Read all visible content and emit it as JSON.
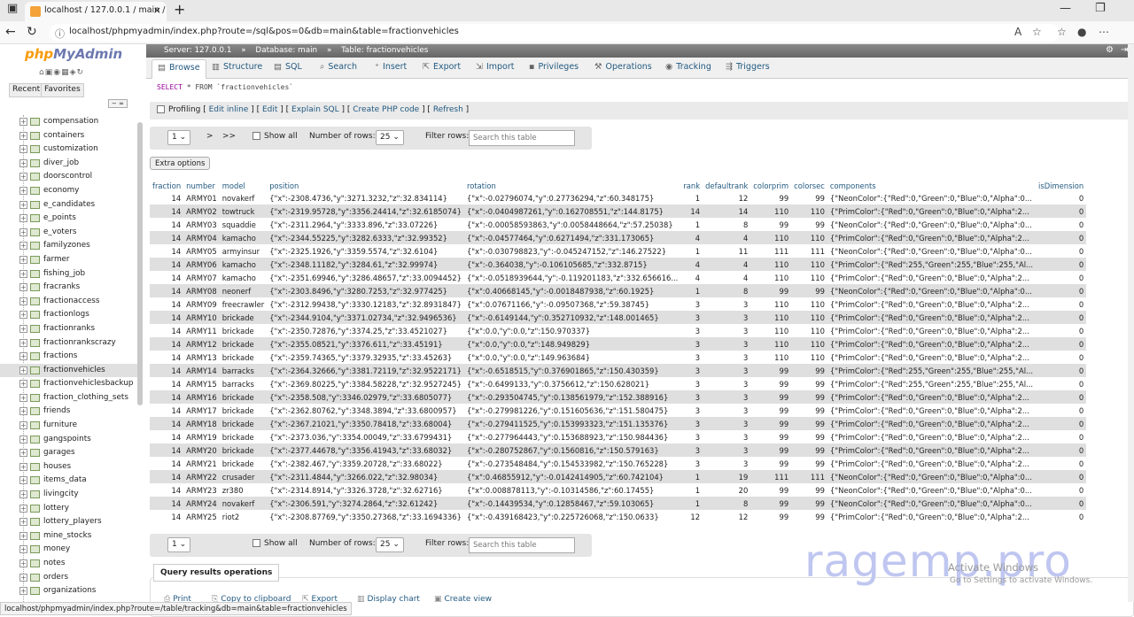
{
  "browser": {
    "tab_title": "localhost / 127.0.0.1 / main / fract",
    "url": "localhost/phpmyadmin/index.php?route=/sql&pos=0&db=main&table=fractionvehicles"
  },
  "sidebar": {
    "logo_php": "php",
    "logo_myadmin": "MyAdmin",
    "recent": "Recent",
    "favorites": "Favorites",
    "items": [
      "compensation",
      "containers",
      "customization",
      "diver_job",
      "doorscontrol",
      "economy",
      "e_candidates",
      "e_points",
      "e_voters",
      "familyzones",
      "farmer",
      "fishing_job",
      "fracranks",
      "fractionaccess",
      "fractionlogs",
      "fractionranks",
      "fractionrankscrazy",
      "fractions",
      "fractionvehicles",
      "fractionvehiclesbackup",
      "fraction_clothing_sets",
      "friends",
      "furniture",
      "gangspoints",
      "garages",
      "houses",
      "items_data",
      "livingcity",
      "lottery",
      "lottery_players",
      "mine_stocks",
      "money",
      "notes",
      "orders",
      "organizations"
    ],
    "active": "fractionvehicles"
  },
  "breadcrumb": {
    "server": "Server: 127.0.0.1",
    "database": "Database: main",
    "table": "Table: fractionvehicles"
  },
  "menu": {
    "browse": "Browse",
    "structure": "Structure",
    "sql": "SQL",
    "search": "Search",
    "insert": "Insert",
    "export": "Export",
    "import": "Import",
    "privileges": "Privileges",
    "operations": "Operations",
    "tracking": "Tracking",
    "triggers": "Triggers"
  },
  "query": {
    "select": "SELECT",
    "rest": " * FROM `fractionvehicles`"
  },
  "profiling": {
    "label": "Profiling",
    "edit_inline": "Edit inline",
    "edit": "Edit",
    "explain": "Explain SQL",
    "create_php": "Create PHP code",
    "refresh": "Refresh"
  },
  "nav": {
    "page": "1",
    "next": ">",
    "last": ">>",
    "show_all": "Show all",
    "rows_label": "Number of rows:",
    "rows_value": "25",
    "filter_label": "Filter rows:",
    "filter_placeholder": "Search this table"
  },
  "extra_options": "Extra options",
  "table": {
    "headers": [
      "fraction",
      "number",
      "model",
      "position",
      "rotation",
      "rank",
      "defaultrank",
      "colorprim",
      "colorsec",
      "components",
      "isDimension"
    ],
    "rows": [
      [
        "14",
        "ARMY01",
        "novakerf",
        "{\"x\":-2308.4736,\"y\":3271.3232,\"z\":32.834114}",
        "{\"x\":-0.02796074,\"y\":0.27736294,\"z\":60.348175}",
        "1",
        "12",
        "99",
        "99",
        "{\"NeonColor\":{\"Red\":0,\"Green\":0,\"Blue\":0,\"Alpha\":0...",
        "0"
      ],
      [
        "14",
        "ARMY02",
        "towtruck",
        "{\"x\":-2319.95728,\"y\":3356.24414,\"z\":32.6185074}",
        "{\"x\":-0.0404987261,\"y\":0.162708551,\"z\":144.8175}",
        "14",
        "14",
        "110",
        "110",
        "{\"PrimColor\":{\"Red\":0,\"Green\":0,\"Blue\":0,\"Alpha\":2...",
        "0"
      ],
      [
        "14",
        "ARMY03",
        "squaddie",
        "{\"x\":-2311.2964,\"y\":3333.896,\"z\":33.07226}",
        "{\"x\":-0.00058593863,\"y\":0.0058448664,\"z\":57.25038}",
        "1",
        "8",
        "99",
        "99",
        "{\"NeonColor\":{\"Red\":0,\"Green\":0,\"Blue\":0,\"Alpha\":0...",
        "0"
      ],
      [
        "14",
        "ARMY04",
        "kamacho",
        "{\"x\":-2344.55225,\"y\":3282.6333,\"z\":32.99352}",
        "{\"x\":-0.04577464,\"y\":0.6271494,\"z\":331.173065}",
        "4",
        "4",
        "110",
        "110",
        "{\"PrimColor\":{\"Red\":0,\"Green\":0,\"Blue\":0,\"Alpha\":2...",
        "0"
      ],
      [
        "14",
        "ARMY05",
        "armyinsur",
        "{\"x\":-2325.1926,\"y\":3359.5574,\"z\":32.6104}",
        "{\"x\":-0.030798823,\"y\":-0.045247152,\"z\":146.27522}",
        "1",
        "11",
        "111",
        "111",
        "{\"NeonColor\":{\"Red\":0,\"Green\":0,\"Blue\":0,\"Alpha\":0...",
        "0"
      ],
      [
        "14",
        "ARMY06",
        "kamacho",
        "{\"x\":-2348.11182,\"y\":3284.61,\"z\":32.99974}",
        "{\"x\":-0.364038,\"y\":-0.106105685,\"z\":332.8715}",
        "4",
        "4",
        "110",
        "110",
        "{\"PrimColor\":{\"Red\":255,\"Green\":255,\"Blue\":255,\"Al...",
        "0"
      ],
      [
        "14",
        "ARMY07",
        "kamacho",
        "{\"x\":-2351.69946,\"y\":3286.48657,\"z\":33.0094452}",
        "{\"x\":-0.0518939644,\"y\":-0.119201183,\"z\":332.656616...",
        "4",
        "4",
        "110",
        "110",
        "{\"PrimColor\":{\"Red\":0,\"Green\":0,\"Blue\":0,\"Alpha\":2...",
        "0"
      ],
      [
        "14",
        "ARMY08",
        "neonerf",
        "{\"x\":-2303.8496,\"y\":3280.7253,\"z\":32.977425}",
        "{\"x\":0.40668145,\"y\":-0.0018487938,\"z\":60.1925}",
        "1",
        "8",
        "99",
        "99",
        "{\"NeonColor\":{\"Red\":0,\"Green\":0,\"Blue\":0,\"Alpha\":0...",
        "0"
      ],
      [
        "14",
        "ARMY09",
        "freecrawler",
        "{\"x\":-2312.99438,\"y\":3330.12183,\"z\":32.8931847}",
        "{\"x\":0.07671166,\"y\":-0.09507368,\"z\":59.38745}",
        "3",
        "3",
        "110",
        "110",
        "{\"PrimColor\":{\"Red\":0,\"Green\":0,\"Blue\":0,\"Alpha\":2...",
        "0"
      ],
      [
        "14",
        "ARMY10",
        "brickade",
        "{\"x\":-2344.9104,\"y\":3371.02734,\"z\":32.9496536}",
        "{\"x\":-0.6149144,\"y\":0.352710932,\"z\":148.001465}",
        "3",
        "3",
        "110",
        "110",
        "{\"PrimColor\":{\"Red\":0,\"Green\":0,\"Blue\":0,\"Alpha\":2...",
        "0"
      ],
      [
        "14",
        "ARMY11",
        "brickade",
        "{\"x\":-2350.72876,\"y\":3374.25,\"z\":33.4521027}",
        "{\"x\":0.0,\"y\":0.0,\"z\":150.970337}",
        "3",
        "3",
        "110",
        "110",
        "{\"PrimColor\":{\"Red\":0,\"Green\":0,\"Blue\":0,\"Alpha\":2...",
        "0"
      ],
      [
        "14",
        "ARMY12",
        "brickade",
        "{\"x\":-2355.08521,\"y\":3376.611,\"z\":33.45191}",
        "{\"x\":0.0,\"y\":0.0,\"z\":148.949829}",
        "3",
        "3",
        "110",
        "110",
        "{\"PrimColor\":{\"Red\":0,\"Green\":0,\"Blue\":0,\"Alpha\":2...",
        "0"
      ],
      [
        "14",
        "ARMY13",
        "brickade",
        "{\"x\":-2359.74365,\"y\":3379.32935,\"z\":33.45263}",
        "{\"x\":0.0,\"y\":0.0,\"z\":149.963684}",
        "3",
        "3",
        "110",
        "110",
        "{\"PrimColor\":{\"Red\":0,\"Green\":0,\"Blue\":0,\"Alpha\":2...",
        "0"
      ],
      [
        "14",
        "ARMY14",
        "barracks",
        "{\"x\":-2364.32666,\"y\":3381.72119,\"z\":32.9522171}",
        "{\"x\":-0.6518515,\"y\":0.376901865,\"z\":150.430359}",
        "3",
        "3",
        "99",
        "99",
        "{\"PrimColor\":{\"Red\":255,\"Green\":255,\"Blue\":255,\"Al...",
        "0"
      ],
      [
        "14",
        "ARMY15",
        "barracks",
        "{\"x\":-2369.80225,\"y\":3384.58228,\"z\":32.9527245}",
        "{\"x\":-0.6499133,\"y\":0.3756612,\"z\":150.628021}",
        "3",
        "3",
        "99",
        "99",
        "{\"PrimColor\":{\"Red\":255,\"Green\":255,\"Blue\":255,\"Al...",
        "0"
      ],
      [
        "14",
        "ARMY16",
        "brickade",
        "{\"x\":-2358.508,\"y\":3346.02979,\"z\":33.6805077}",
        "{\"x\":-0.293504745,\"y\":0.138561979,\"z\":152.388916}",
        "3",
        "3",
        "99",
        "99",
        "{\"PrimColor\":{\"Red\":0,\"Green\":0,\"Blue\":0,\"Alpha\":2...",
        "0"
      ],
      [
        "14",
        "ARMY17",
        "brickade",
        "{\"x\":-2362.80762,\"y\":3348.3894,\"z\":33.6800957}",
        "{\"x\":-0.279981226,\"y\":0.151605636,\"z\":151.580475}",
        "3",
        "3",
        "99",
        "99",
        "{\"PrimColor\":{\"Red\":0,\"Green\":0,\"Blue\":0,\"Alpha\":2...",
        "0"
      ],
      [
        "14",
        "ARMY18",
        "brickade",
        "{\"x\":-2367.21021,\"y\":3350.78418,\"z\":33.68004}",
        "{\"x\":-0.279411525,\"y\":0.153993323,\"z\":151.135376}",
        "3",
        "3",
        "99",
        "99",
        "{\"PrimColor\":{\"Red\":0,\"Green\":0,\"Blue\":0,\"Alpha\":2...",
        "0"
      ],
      [
        "14",
        "ARMY19",
        "brickade",
        "{\"x\":-2373.036,\"y\":3354.00049,\"z\":33.6799431}",
        "{\"x\":-0.277964443,\"y\":0.153688923,\"z\":150.984436}",
        "3",
        "3",
        "99",
        "99",
        "{\"PrimColor\":{\"Red\":0,\"Green\":0,\"Blue\":0,\"Alpha\":2...",
        "0"
      ],
      [
        "14",
        "ARMY20",
        "brickade",
        "{\"x\":-2377.44678,\"y\":3356.41943,\"z\":33.68032}",
        "{\"x\":-0.280752867,\"y\":0.1560816,\"z\":150.579163}",
        "3",
        "3",
        "99",
        "99",
        "{\"PrimColor\":{\"Red\":0,\"Green\":0,\"Blue\":0,\"Alpha\":2...",
        "0"
      ],
      [
        "14",
        "ARMY21",
        "brickade",
        "{\"x\":-2382.467,\"y\":3359.20728,\"z\":33.68022}",
        "{\"x\":-0.273548484,\"y\":0.154533982,\"z\":150.765228}",
        "3",
        "3",
        "99",
        "99",
        "{\"PrimColor\":{\"Red\":0,\"Green\":0,\"Blue\":0,\"Alpha\":2...",
        "0"
      ],
      [
        "14",
        "ARMY22",
        "crusader",
        "{\"x\":-2311.4844,\"y\":3266.022,\"z\":32.98034}",
        "{\"x\":0.46855912,\"y\":-0.0142414905,\"z\":60.742104}",
        "1",
        "19",
        "111",
        "111",
        "{\"NeonColor\":{\"Red\":0,\"Green\":0,\"Blue\":0,\"Alpha\":0...",
        "0"
      ],
      [
        "14",
        "ARMY23",
        "zr380",
        "{\"x\":-2314.8914,\"y\":3326.3728,\"z\":32.62716}",
        "{\"x\":0.008878113,\"y\":-0.10314586,\"z\":60.17455}",
        "1",
        "20",
        "99",
        "99",
        "{\"NeonColor\":{\"Red\":0,\"Green\":0,\"Blue\":0,\"Alpha\":0...",
        "0"
      ],
      [
        "14",
        "ARMY24",
        "novakerf",
        "{\"x\":-2306.591,\"y\":3274.2864,\"z\":32.61242}",
        "{\"x\":-0.14439534,\"y\":0.12858467,\"z\":59.103065}",
        "1",
        "8",
        "99",
        "99",
        "{\"NeonColor\":{\"Red\":0,\"Green\":0,\"Blue\":0,\"Alpha\":0...",
        "0"
      ],
      [
        "14",
        "ARMY25",
        "riot2",
        "{\"x\":-2308.87769,\"y\":3350.27368,\"z\":33.1694336}",
        "{\"x\":-0.439168423,\"y\":0.225726068,\"z\":150.0633}",
        "12",
        "12",
        "99",
        "99",
        "{\"PrimColor\":{\"Red\":0,\"Green\":0,\"Blue\":0,\"Alpha\":2...",
        "0"
      ]
    ]
  },
  "query_ops": {
    "title": "Query results operations",
    "print": "Print",
    "copy": "Copy to clipboard",
    "export": "Export",
    "chart": "Display chart",
    "view": "Create view"
  },
  "status_url": "localhost/phpmyadmin/index.php?route=/table/tracking&db=main&table=fractionvehicles",
  "watermark": "ragemp.pro",
  "activate": {
    "title": "Activate Windows",
    "sub": "Go to Settings to activate Windows."
  }
}
